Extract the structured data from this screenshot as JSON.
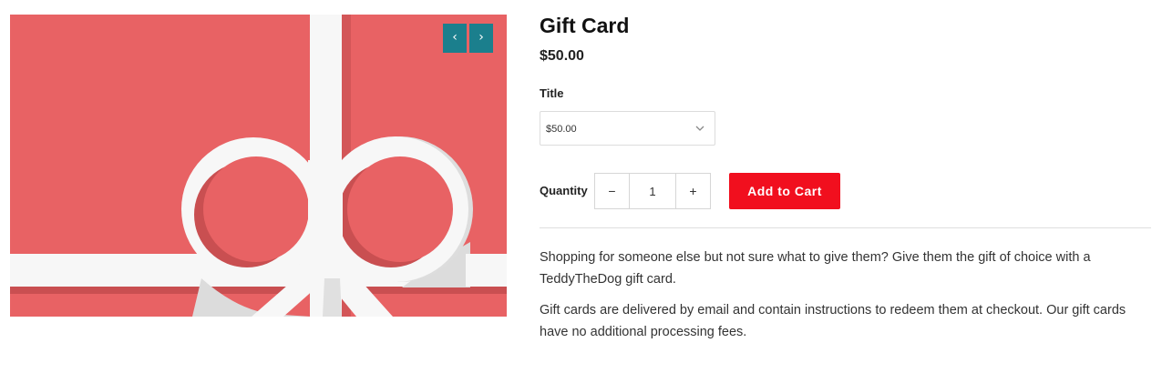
{
  "product": {
    "title": "Gift Card",
    "price": "$50.00"
  },
  "gallery": {
    "prev_icon": "chevron-left-icon",
    "next_icon": "chevron-right-icon",
    "prev_glyph": "‹",
    "next_glyph": "›",
    "nav_color": "#1b7f8d",
    "card_color": "#e86264",
    "ribbon_color": "#f7f7f7"
  },
  "options": {
    "label": "Title",
    "selected": "$50.00",
    "dropdown_icon": "chevron-down-icon"
  },
  "quantity": {
    "label": "Quantity",
    "minus": "−",
    "plus": "+",
    "value": "1"
  },
  "cart": {
    "add_label": "Add to Cart",
    "button_color": "#f10f1e"
  },
  "description": {
    "paragraph1": "Shopping for someone else but not sure what to give them? Give them the gift of choice with a TeddyTheDog gift card.",
    "paragraph2": "Gift cards are delivered by email and contain instructions to redeem them at checkout. Our gift cards have no additional processing fees."
  }
}
